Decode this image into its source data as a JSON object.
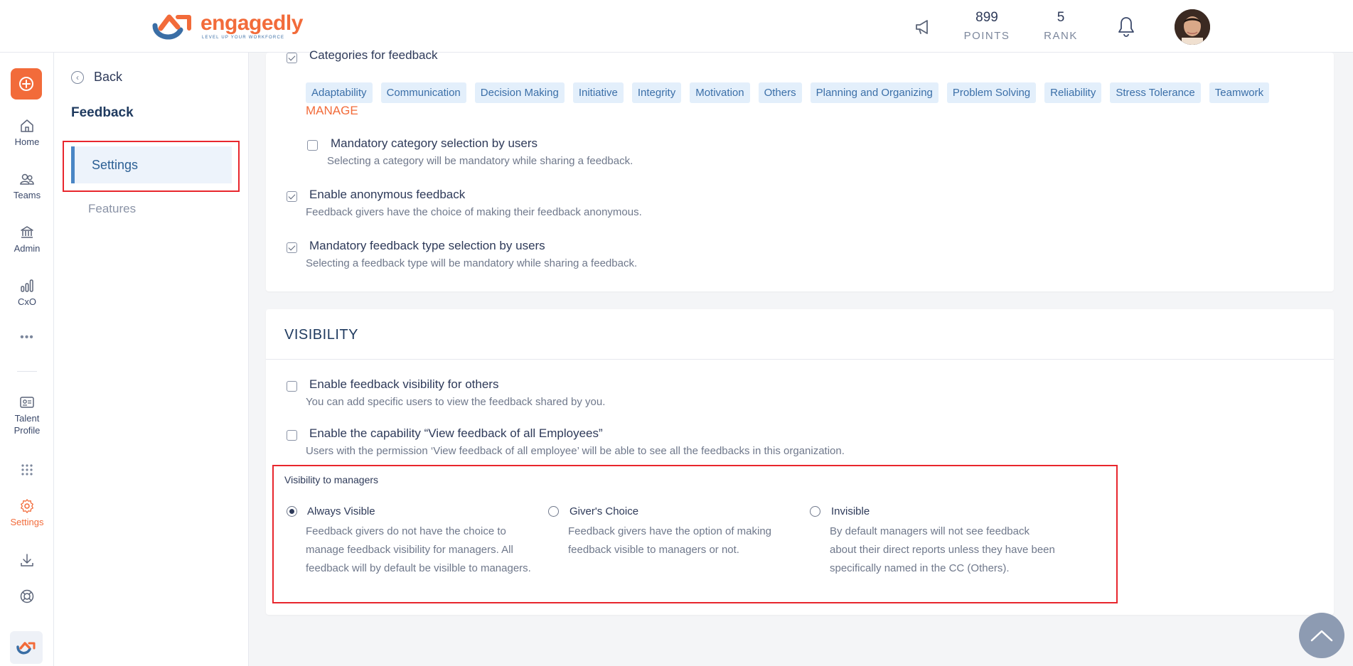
{
  "header": {
    "logo_text": "engagedly",
    "logo_tagline": "LEVEL UP YOUR WORKFORCE",
    "points_value": "899",
    "points_label": "POINTS",
    "rank_value": "5",
    "rank_label": "RANK"
  },
  "rail": {
    "items": [
      {
        "label": "Home",
        "icon": "home-icon"
      },
      {
        "label": "Teams",
        "icon": "teams-icon"
      },
      {
        "label": "Admin",
        "icon": "admin-icon"
      },
      {
        "label": "CxO",
        "icon": "cxo-icon"
      },
      {
        "label": "Talent Profile",
        "icon": "talent-profile-icon"
      },
      {
        "label": "Settings",
        "icon": "settings-icon"
      }
    ]
  },
  "subnav": {
    "back_label": "Back",
    "title": "Feedback",
    "items": [
      {
        "label": "Settings",
        "active": true
      },
      {
        "label": "Features",
        "active": false
      }
    ]
  },
  "categories": {
    "title": "Categories for feedback",
    "checked": true,
    "tags": [
      "Adaptability",
      "Communication",
      "Decision Making",
      "Initiative",
      "Integrity",
      "Motivation",
      "Others",
      "Planning and Organizing",
      "Problem Solving",
      "Reliability",
      "Stress Tolerance",
      "Teamwork"
    ],
    "manage_label": "MANAGE"
  },
  "settings": [
    {
      "title": "Mandatory category selection by users",
      "desc": "Selecting a category will be mandatory while sharing a feedback.",
      "checked": false
    },
    {
      "title": "Enable anonymous feedback",
      "desc": "Feedback givers have the choice of making their feedback anonymous.",
      "checked": true
    },
    {
      "title": "Mandatory feedback type selection by users",
      "desc": "Selecting a feedback type will be mandatory while sharing a feedback.",
      "checked": true
    }
  ],
  "visibility": {
    "title": "VISIBILITY",
    "options": [
      {
        "title": "Enable feedback visibility for others",
        "desc": "You can add specific users to view the feedback shared by you.",
        "checked": false
      },
      {
        "title": "Enable the capability “View feedback of all Employees”",
        "desc": "Users with the permission ‘View feedback of all employee’ will be able to see all the feedbacks in this organization.",
        "checked": false
      }
    ],
    "managers_label": "Visibility to managers",
    "radios": [
      {
        "title": "Always Visible",
        "desc": "Feedback givers do not have the choice to manage feedback visibility for managers. All feedback will by default be visilble to managers.",
        "selected": true
      },
      {
        "title": "Giver's Choice",
        "desc": "Feedback givers have the option of making feedback visible to managers or not.",
        "selected": false
      },
      {
        "title": "Invisible",
        "desc": "By default managers will not see feedback about their direct reports unless they have been specifically named in the CC (Others).",
        "selected": false
      }
    ]
  },
  "colors": {
    "accent": "#f26b3a",
    "highlight_box": "#e8262d",
    "active_nav": "#4a86c5"
  }
}
